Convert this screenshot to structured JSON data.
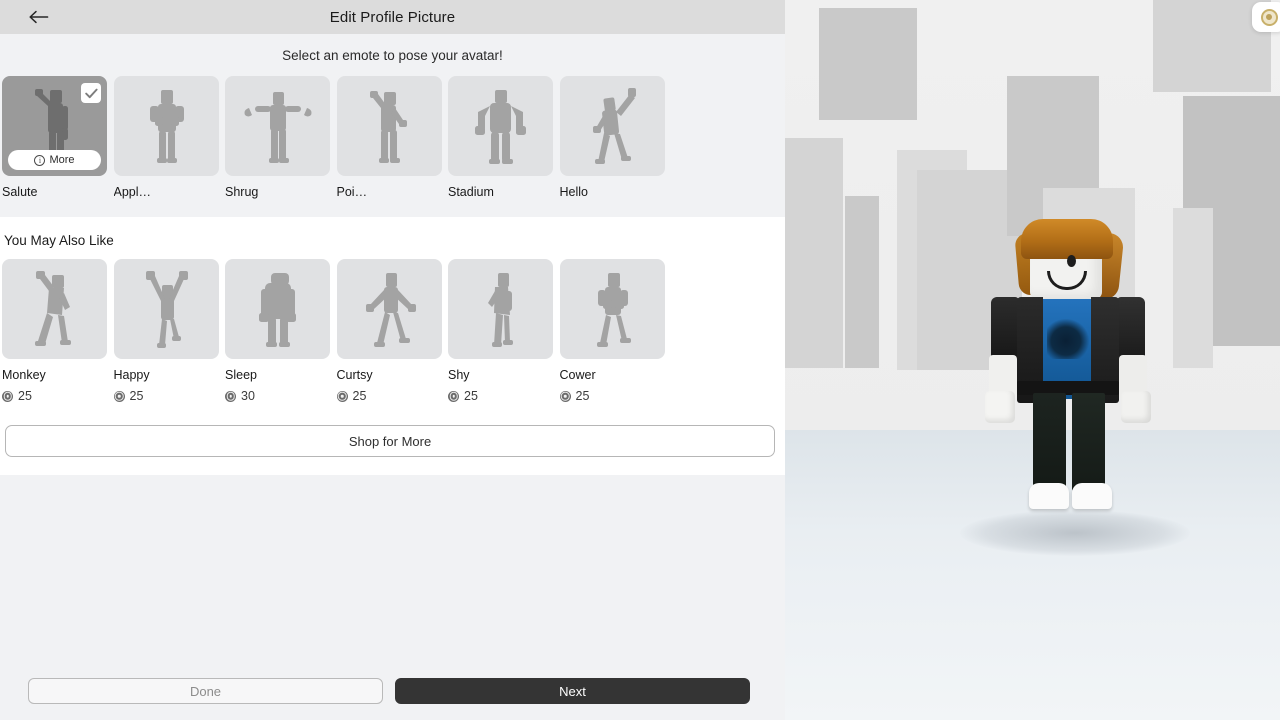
{
  "header": {
    "title": "Edit Profile Picture",
    "back_icon": "arrow-left-icon"
  },
  "viewport": {
    "fab_icon": "coin-badge-icon",
    "avatar_description": "Roblox avatar with orange hair, black jacket, blue graphic t-shirt, dark jeans and white sneakers"
  },
  "emotes_section": {
    "instruction": "Select an emote to pose your avatar!",
    "more_label": "More",
    "more_icon": "info-circle-icon",
    "check_icon": "check-icon",
    "items": [
      {
        "label": "Salute",
        "selected": true,
        "pose": "salute"
      },
      {
        "label": "Appl…",
        "selected": false,
        "pose": "applaud"
      },
      {
        "label": "Shrug",
        "selected": false,
        "pose": "shrug"
      },
      {
        "label": "Poi…",
        "selected": false,
        "pose": "point"
      },
      {
        "label": "Stadium",
        "selected": false,
        "pose": "stadium"
      },
      {
        "label": "Hello",
        "selected": false,
        "pose": "hello"
      }
    ]
  },
  "suggest_section": {
    "title": "You May Also Like",
    "currency_icon": "robux-coin-icon",
    "items": [
      {
        "label": "Monkey",
        "price": "25",
        "pose": "monkey"
      },
      {
        "label": "Happy",
        "price": "25",
        "pose": "happy"
      },
      {
        "label": "Sleep",
        "price": "30",
        "pose": "sleep"
      },
      {
        "label": "Curtsy",
        "price": "25",
        "pose": "curtsy"
      },
      {
        "label": "Shy",
        "price": "25",
        "pose": "shy"
      },
      {
        "label": "Cower",
        "price": "25",
        "pose": "cower"
      }
    ],
    "shop_button": "Shop for More"
  },
  "footer": {
    "done_label": "Done",
    "next_label": "Next"
  },
  "colors": {
    "titlebar": "#dcdcdc",
    "panel": "#f1f2f4",
    "tile": "#e0e1e3",
    "tile_selected": "#9a9a9a",
    "next_button": "#343434",
    "silhouette": "#a3a3a3"
  }
}
